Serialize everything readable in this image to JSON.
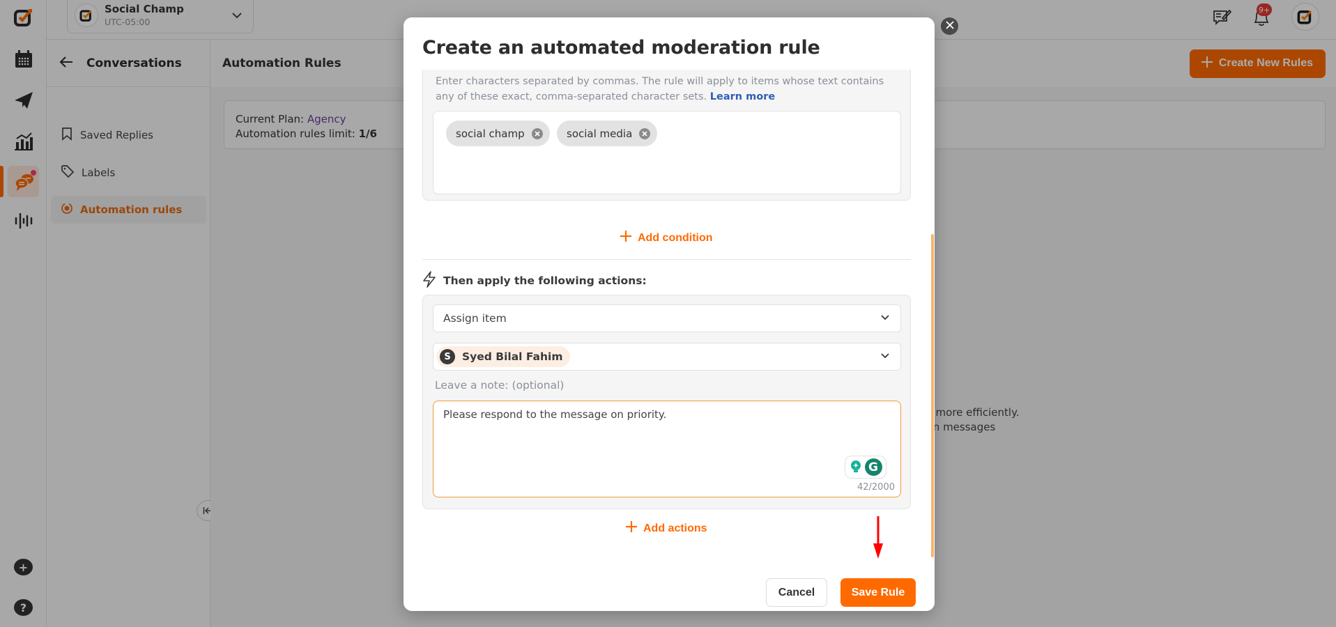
{
  "app": {
    "workspace": {
      "name": "Social Champ",
      "timezone": "UTC-05:00"
    },
    "notifications_badge": "9+"
  },
  "rail": {
    "items": [
      {
        "icon": "logo-icon"
      },
      {
        "icon": "calendar-icon"
      },
      {
        "icon": "publish-send-icon"
      },
      {
        "icon": "analytics-icon"
      },
      {
        "icon": "conversations-chat-icon",
        "active": true
      },
      {
        "icon": "listening-waveform-icon"
      }
    ],
    "bottom": [
      {
        "icon": "plus-icon",
        "label": "+"
      },
      {
        "icon": "help-icon",
        "label": "?"
      }
    ]
  },
  "subnav": {
    "title": "Conversations",
    "items": [
      {
        "label": "Saved Replies",
        "icon": "bookmark-icon"
      },
      {
        "label": "Labels",
        "icon": "tag-icon"
      },
      {
        "label": "Automation rules",
        "icon": "automation-icon",
        "active": true
      }
    ]
  },
  "content": {
    "title": "Automation Rules",
    "create_button": "Create New Rules",
    "plan_label": "Current Plan: ",
    "plan_value": "Agency",
    "limit_label": "Automation rules limit: ",
    "limit_value": "1/6",
    "background_line1": "ages more efficiently.",
    "background_line2": "ion on messages"
  },
  "modal": {
    "title": "Create an automated moderation rule",
    "condition_help": "Enter characters separated by commas. The rule will apply to items whose text contains any of these exact, comma-separated character sets.",
    "learn_more": "Learn more",
    "keywords": [
      "social champ",
      "social media"
    ],
    "add_condition": "Add condition",
    "actions_heading": "Then apply the following actions:",
    "action_type": "Assign item",
    "assignee": {
      "initial": "S",
      "name": "Syed Bilal Fahim"
    },
    "note_label": "Leave a note: (optional)",
    "note_value": "Please respond to the message on priority.",
    "note_count": "42/2000",
    "add_actions": "Add actions",
    "cancel": "Cancel",
    "save": "Save Rule"
  },
  "colors": {
    "accent": "#ff6a00",
    "link": "#2f5fb3",
    "plan": "#6b3fa0",
    "annotation_arrow": "#ff0000"
  }
}
